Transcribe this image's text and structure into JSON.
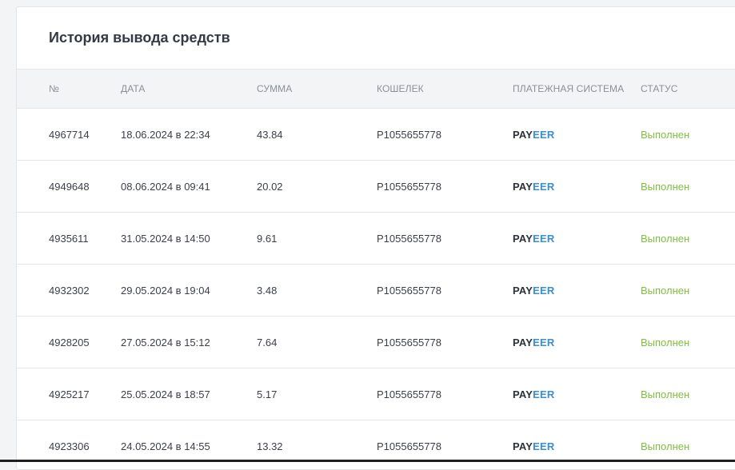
{
  "panel": {
    "title": "История вывода средств"
  },
  "table": {
    "headers": {
      "num": "№",
      "date": "ДАТА",
      "sum": "СУММА",
      "wallet": "КОШЕЛЕК",
      "system": "ПЛАТЕЖНАЯ СИСТЕМА",
      "status": "СТАТУС"
    },
    "rows": [
      {
        "num": "4967714",
        "date": "18.06.2024 в 22:34",
        "sum": "43.84",
        "wallet": "P1055655778",
        "system_a": "PAY",
        "system_b": "EER",
        "status": "Выполнен"
      },
      {
        "num": "4949648",
        "date": "08.06.2024 в 09:41",
        "sum": "20.02",
        "wallet": "P1055655778",
        "system_a": "PAY",
        "system_b": "EER",
        "status": "Выполнен"
      },
      {
        "num": "4935611",
        "date": "31.05.2024 в 14:50",
        "sum": "9.61",
        "wallet": "P1055655778",
        "system_a": "PAY",
        "system_b": "EER",
        "status": "Выполнен"
      },
      {
        "num": "4932302",
        "date": "29.05.2024 в 19:04",
        "sum": "3.48",
        "wallet": "P1055655778",
        "system_a": "PAY",
        "system_b": "EER",
        "status": "Выполнен"
      },
      {
        "num": "4928205",
        "date": "27.05.2024 в 15:12",
        "sum": "7.64",
        "wallet": "P1055655778",
        "system_a": "PAY",
        "system_b": "EER",
        "status": "Выполнен"
      },
      {
        "num": "4925217",
        "date": "25.05.2024 в 18:57",
        "sum": "5.17",
        "wallet": "P1055655778",
        "system_a": "PAY",
        "system_b": "EER",
        "status": "Выполнен"
      },
      {
        "num": "4923306",
        "date": "24.05.2024 в 14:55",
        "sum": "13.32",
        "wallet": "P1055655778",
        "system_a": "PAY",
        "system_b": "EER",
        "status": "Выполнен"
      }
    ]
  },
  "colors": {
    "status_success": "#7fbf3f",
    "payeer_dark": "#2d3036",
    "payeer_blue": "#3a8fd0",
    "header_bg": "#f3f4f6"
  }
}
